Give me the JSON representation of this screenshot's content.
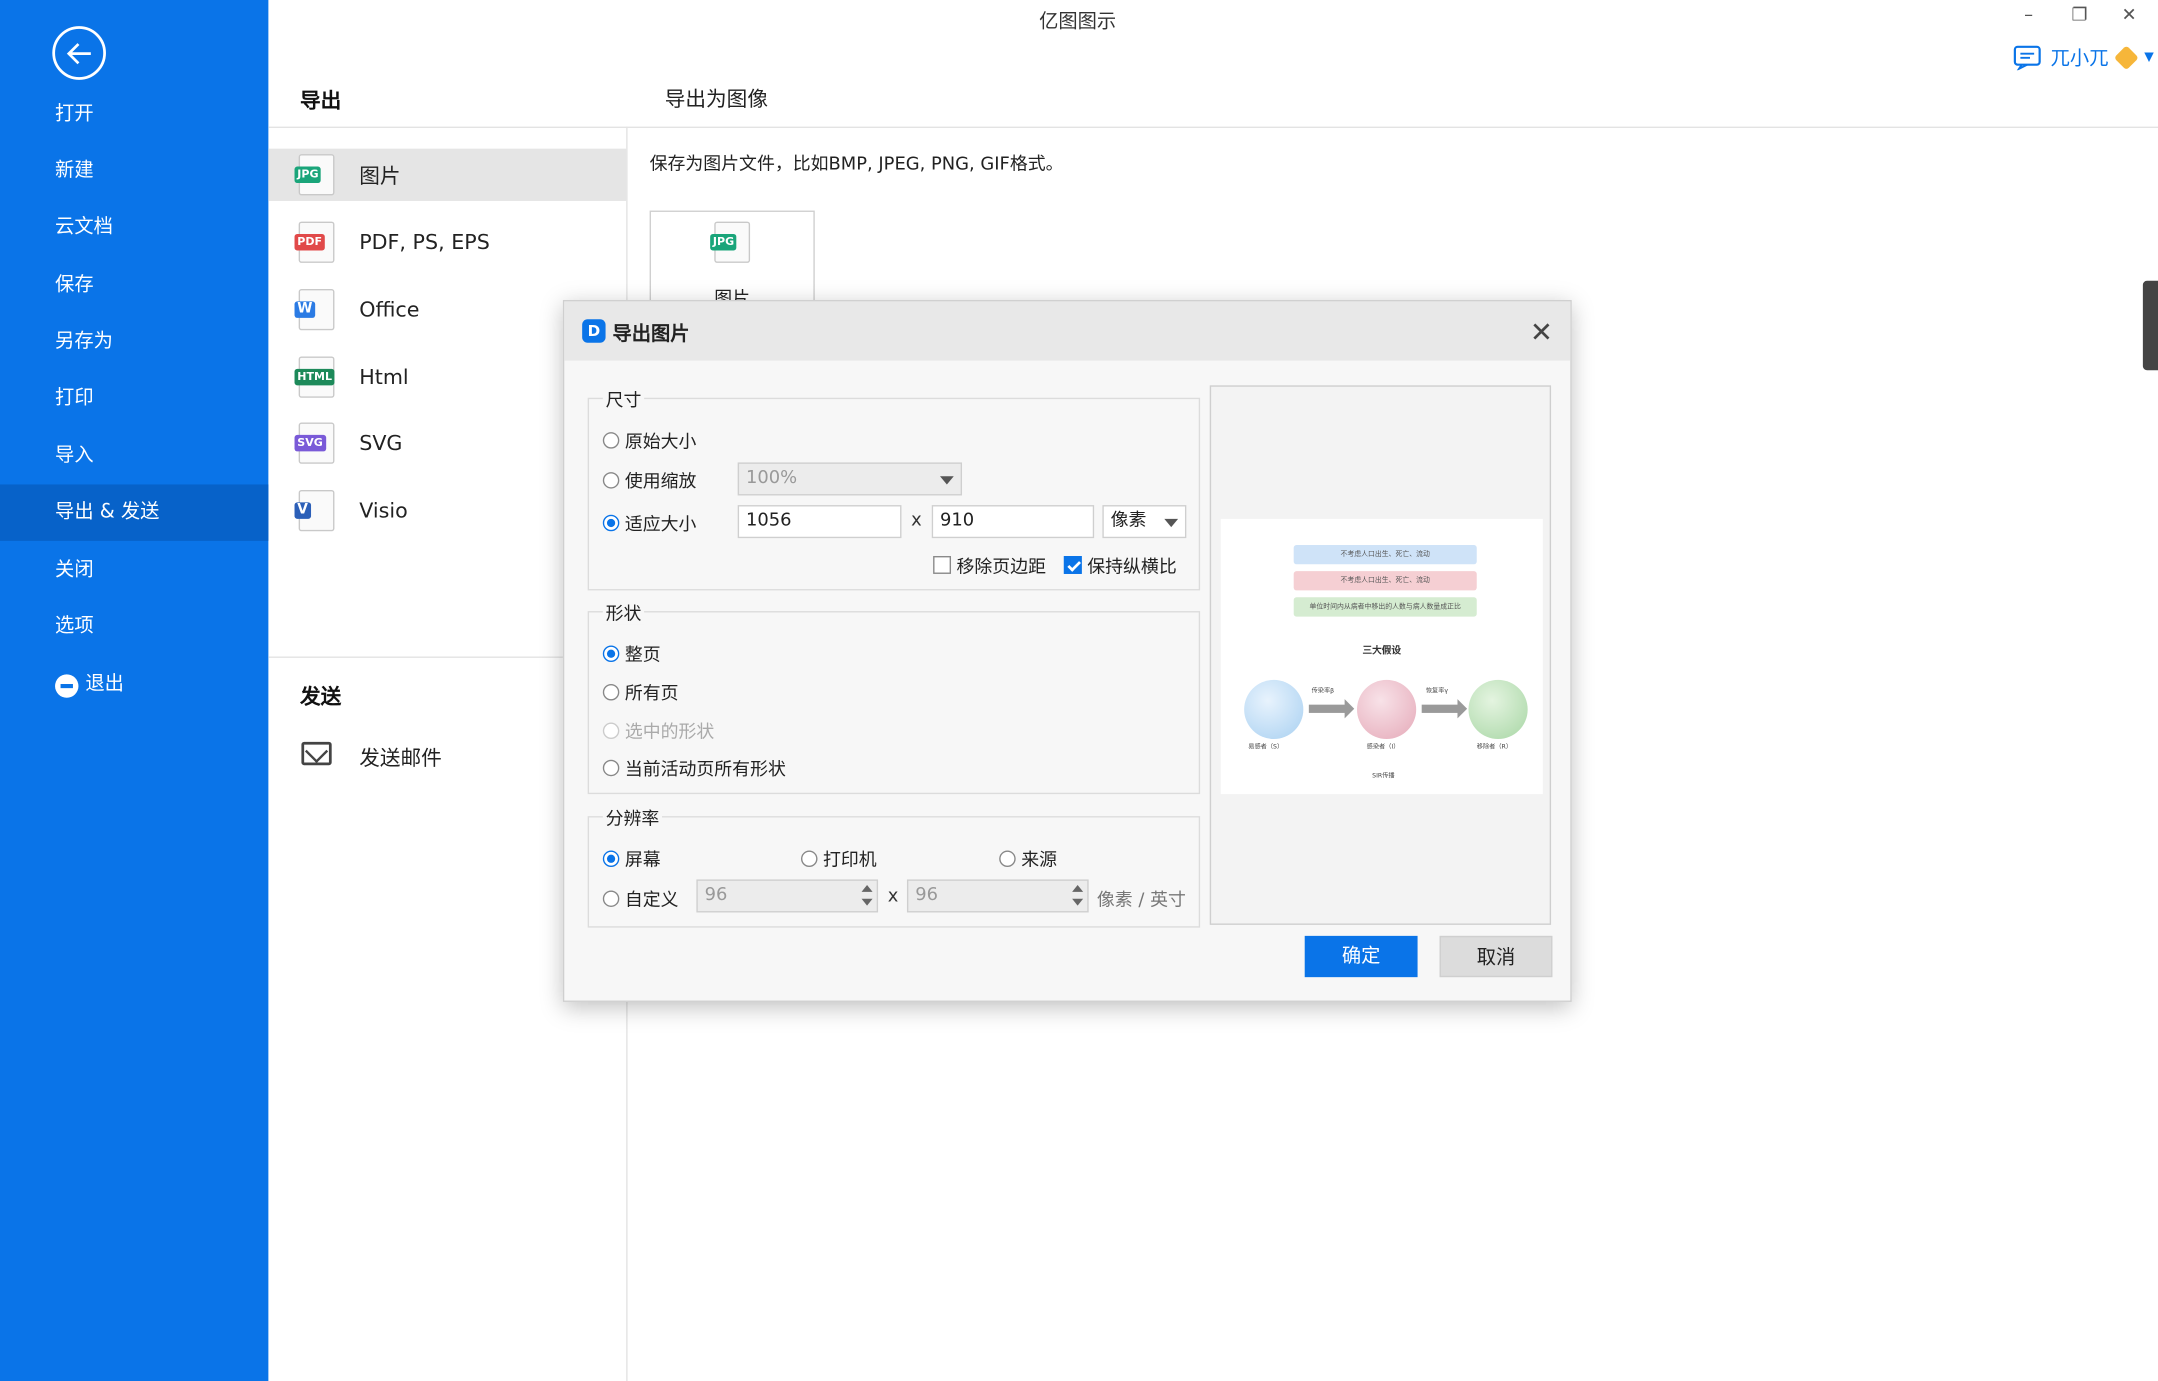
{
  "app": {
    "title": "亿图图示",
    "user_name": "兀小兀"
  },
  "sidebar": {
    "items": [
      {
        "label": "打开"
      },
      {
        "label": "新建"
      },
      {
        "label": "云文档"
      },
      {
        "label": "保存"
      },
      {
        "label": "另存为"
      },
      {
        "label": "打印"
      },
      {
        "label": "导入"
      },
      {
        "label": "导出 & 发送"
      },
      {
        "label": "关闭"
      },
      {
        "label": "选项"
      },
      {
        "label": "退出"
      }
    ],
    "active_index": 7
  },
  "export_panel": {
    "heading": "导出",
    "formats": [
      {
        "label": "图片",
        "icon": "jpg-file-icon",
        "tag": "JPG",
        "color": "#1aa57a"
      },
      {
        "label": "PDF, PS, EPS",
        "icon": "pdf-file-icon",
        "tag": "PDF",
        "color": "#e14a4a"
      },
      {
        "label": "Office",
        "icon": "word-file-icon",
        "tag": "W",
        "color": "#2b7be4"
      },
      {
        "label": "Html",
        "icon": "html-file-icon",
        "tag": "HTML",
        "color": "#1d8a5a"
      },
      {
        "label": "SVG",
        "icon": "svg-file-icon",
        "tag": "SVG",
        "color": "#7a5ad8"
      },
      {
        "label": "Visio",
        "icon": "visio-file-icon",
        "tag": "V",
        "color": "#2b5fb8"
      }
    ],
    "send_heading": "发送",
    "send_mail": "发送邮件"
  },
  "main": {
    "title": "导出为图像",
    "description": "保存为图片文件，比如BMP, JPEG, PNG, GIF格式。",
    "tile_label": "图片",
    "tile_tag": "JPG"
  },
  "dialog": {
    "logo": "D",
    "title": "导出图片",
    "size": {
      "group": "尺寸",
      "original": "原始大小",
      "use_scale": "使用缩放",
      "scale_value": "100%",
      "fit_size": "适应大小",
      "width": "1056",
      "x_sep": "x",
      "height": "910",
      "unit": "像素",
      "remove_margin": "移除页边距",
      "keep_ratio": "保持纵横比"
    },
    "shape": {
      "group": "形状",
      "whole_page": "整页",
      "all_pages": "所有页",
      "selected": "选中的形状",
      "active_page": "当前活动页所有形状"
    },
    "resolution": {
      "group": "分辨率",
      "screen": "屏幕",
      "printer": "打印机",
      "source": "来源",
      "custom": "自定义",
      "x_dpi": "96",
      "y_dpi": "96",
      "unit": "像素 / 英寸"
    },
    "preview": {
      "bar1": "不考虑人口出生、死亡、流动",
      "bar2": "不考虑人口出生、死亡、流动",
      "bar3": "单位时间内从病者中移出的人数与病人数量成正比",
      "center_title": "三大假设",
      "label_s": "易感者（S）",
      "label_i": "感染者（I）",
      "label_r": "移除者（R）",
      "arrow1": "传染率β",
      "arrow2": "恢复率γ",
      "caption": "SIR传播"
    },
    "ok": "确定",
    "cancel": "取消"
  }
}
